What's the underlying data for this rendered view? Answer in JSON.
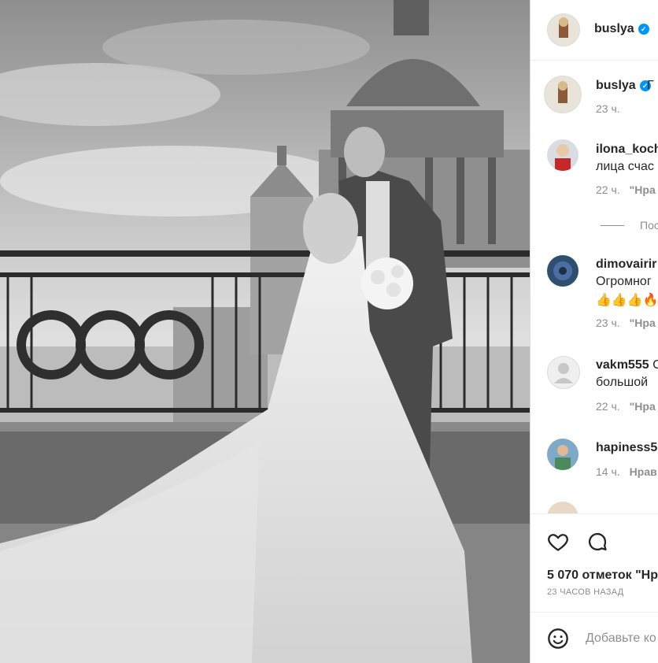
{
  "post": {
    "author": "buslya",
    "caption_fragment": "Г",
    "caption_time": "23 ч."
  },
  "comments": [
    {
      "user": "ilona_koch",
      "text": "лица счас",
      "time": "22 ч.",
      "action": "\"Нра"
    },
    {
      "show_replies": "Пос"
    },
    {
      "user": "dimovairir",
      "text": "Огромног",
      "emoji": "👍👍👍🔥",
      "time": "23 ч.",
      "action": "\"Нра"
    },
    {
      "user": "vakm555",
      "text_suffix": "С",
      "text": "большой",
      "time": "22 ч.",
      "action": "\"Нра"
    },
    {
      "user": "hapiness5",
      "time": "14 ч.",
      "action": "Нрав"
    }
  ],
  "likes": {
    "count_text": "5 070 отметок \"Нр"
  },
  "post_age": "23 ЧАСОВ НАЗАД",
  "add_comment": {
    "placeholder": "Добавьте ко"
  },
  "icons": {
    "like": "heart-outline-icon",
    "comment": "speech-bubble-icon",
    "emoji": "smiley-icon",
    "verified": "verified-badge-icon"
  },
  "colors": {
    "verified": "#0095f6",
    "muted": "#8e8e8e",
    "border": "#dbdbdb"
  }
}
